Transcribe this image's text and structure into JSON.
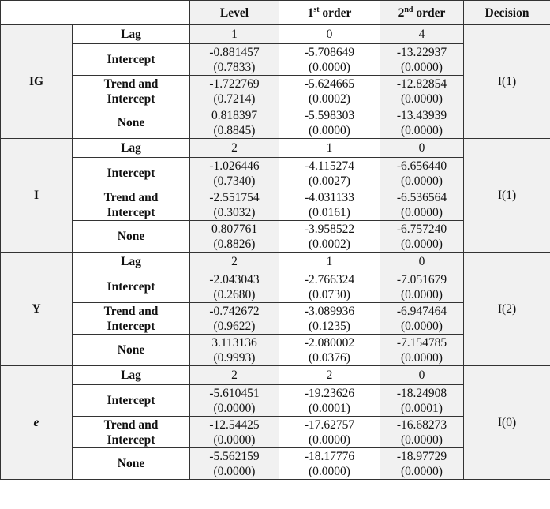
{
  "header": {
    "blank": "",
    "level": "Level",
    "first_order_num": "1",
    "first_order_sup": "st",
    "first_order_text": " order",
    "second_order_num": "2",
    "second_order_sup": "nd",
    "second_order_text": " order",
    "decision": "Decision"
  },
  "groups": [
    {
      "variable": "IG",
      "decision": "I(1)",
      "lag": {
        "label": "Lag",
        "level": "1",
        "first": "0",
        "second": "4"
      },
      "intercept": {
        "label": "Intercept",
        "level": "-0.881457",
        "level_p": "(0.7833)",
        "first": "-5.708649",
        "first_p": "(0.0000)",
        "second": "-13.22937",
        "second_p": "(0.0000)"
      },
      "trend": {
        "label_1": "Trend and",
        "label_2": "Intercept",
        "level": "-1.722769",
        "level_p": "(0.7214)",
        "first": "-5.624665",
        "first_p": "(0.0002)",
        "second": "-12.82854",
        "second_p": "(0.0000)"
      },
      "none": {
        "label": "None",
        "level": "0.818397",
        "level_p": "(0.8845)",
        "first": "-5.598303",
        "first_p": "(0.0000)",
        "second": "-13.43939",
        "second_p": "(0.0000)"
      }
    },
    {
      "variable": "I",
      "decision": "I(1)",
      "lag": {
        "label": "Lag",
        "level": "2",
        "first": "1",
        "second": "0"
      },
      "intercept": {
        "label": "Intercept",
        "level": "-1.026446",
        "level_p": "(0.7340)",
        "first": "-4.115274",
        "first_p": "(0.0027)",
        "second": "-6.656440",
        "second_p": "(0.0000)"
      },
      "trend": {
        "label_1": "Trend and",
        "label_2": "Intercept",
        "level": "-2.551754",
        "level_p": "(0.3032)",
        "first": "-4.031133",
        "first_p": "(0.0161)",
        "second": "-6.536564",
        "second_p": "(0.0000)"
      },
      "none": {
        "label": "None",
        "level": "0.807761",
        "level_p": "(0.8826)",
        "first": "-3.958522",
        "first_p": "(0.0002)",
        "second": "-6.757240",
        "second_p": "(0.0000)"
      }
    },
    {
      "variable": "Y",
      "decision": "I(2)",
      "lag": {
        "label": "Lag",
        "level": "2",
        "first": "1",
        "second": "0"
      },
      "intercept": {
        "label": "Intercept",
        "level": "-2.043043",
        "level_p": "(0.2680)",
        "first": "-2.766324",
        "first_p": "(0.0730)",
        "second": "-7.051679",
        "second_p": "(0.0000)"
      },
      "trend": {
        "label_1": "Trend and",
        "label_2": "Intercept",
        "level": "-0.742672",
        "level_p": "(0.9622)",
        "first": "-3.089936",
        "first_p": "(0.1235)",
        "second": "-6.947464",
        "second_p": "(0.0000)"
      },
      "none": {
        "label": "None",
        "level": "3.113136",
        "level_p": "(0.9993)",
        "first": "-2.080002",
        "first_p": "(0.0376)",
        "second": "-7.154785",
        "second_p": "(0.0000)"
      }
    },
    {
      "variable": "e",
      "decision": "I(0)",
      "lag": {
        "label": "Lag",
        "level": "2",
        "first": "2",
        "second": "0"
      },
      "intercept": {
        "label": "Intercept",
        "level": "-5.610451",
        "level_p": "(0.0000)",
        "first": "-19.23626",
        "first_p": "(0.0001)",
        "second": "-18.24908",
        "second_p": "(0.0001)"
      },
      "trend": {
        "label_1": "Trend and",
        "label_2": "Intercept",
        "level": "-12.54425",
        "level_p": "(0.0000)",
        "first": "-17.62757",
        "first_p": "(0.0000)",
        "second": "-16.68273",
        "second_p": "(0.0000)"
      },
      "none": {
        "label": "None",
        "level": "-5.562159",
        "level_p": "(0.0000)",
        "first": "-18.17776",
        "first_p": "(0.0000)",
        "second": "-18.97729",
        "second_p": "(0.0000)"
      }
    }
  ]
}
